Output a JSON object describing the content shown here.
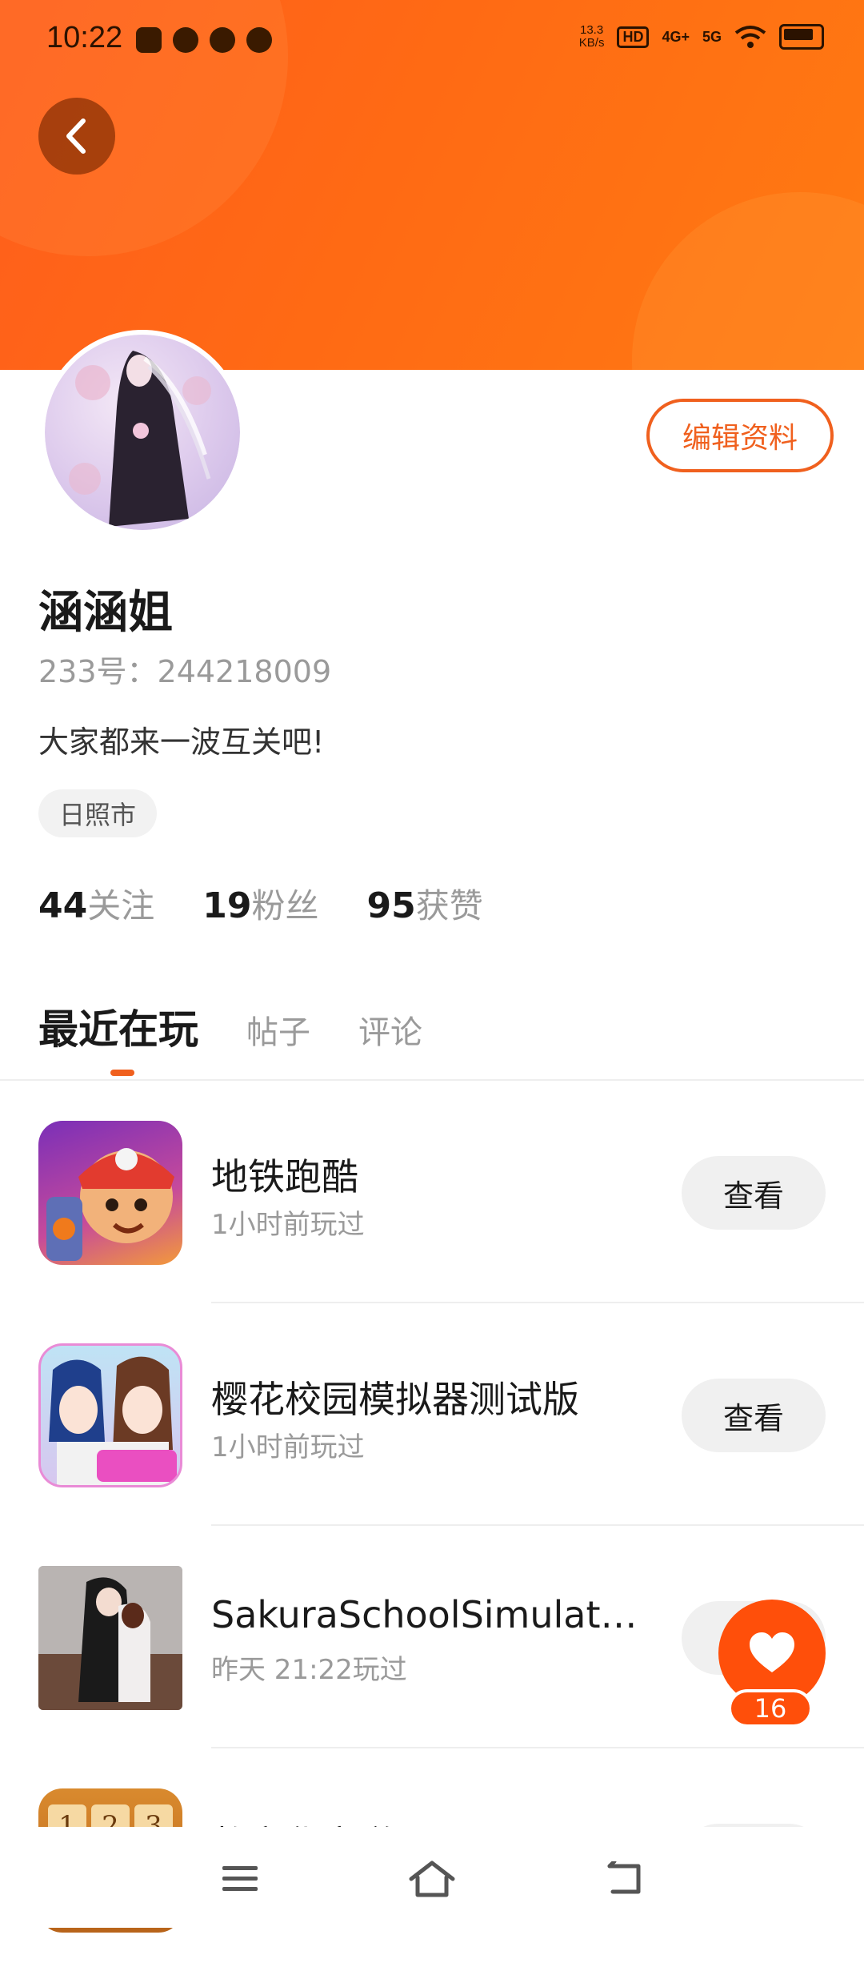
{
  "status_bar": {
    "time": "10:22",
    "net_speed_value": "13.3",
    "net_speed_unit": "KB/s",
    "hd_label": "HD",
    "signal_1": "4G+",
    "signal_2": "5G"
  },
  "profile": {
    "nickname": "涵涵姐",
    "user_id": "233号：244218009",
    "bio": "大家都来一波互关吧!",
    "location": "日照市",
    "edit_button": "编辑资料",
    "stats": [
      {
        "num": "44",
        "label": "关注"
      },
      {
        "num": "19",
        "label": "粉丝"
      },
      {
        "num": "95",
        "label": "获赞"
      }
    ]
  },
  "tabs": [
    {
      "label": "最近在玩",
      "active": true
    },
    {
      "label": "帖子",
      "active": false
    },
    {
      "label": "评论",
      "active": false
    }
  ],
  "games": [
    {
      "name": "地铁跑酷",
      "time": "1小时前玩过",
      "action": "查看"
    },
    {
      "name": "樱花校园模拟器测试版",
      "time": "1小时前玩过",
      "action": "查看"
    },
    {
      "name": "SakuraSchoolSimulat…",
      "time": "昨天 21:22玩过",
      "action": "查看"
    },
    {
      "name": "数字华容道",
      "time": "",
      "action": "查看"
    }
  ],
  "like_fab": {
    "count": "16",
    "icon": "heart-icon"
  },
  "nav": {
    "icons": [
      "menu-icon",
      "home-icon",
      "back-icon"
    ]
  },
  "colors": {
    "accent": "#f0601e",
    "header": "#ff6a14",
    "fab": "#ff4f0a"
  }
}
